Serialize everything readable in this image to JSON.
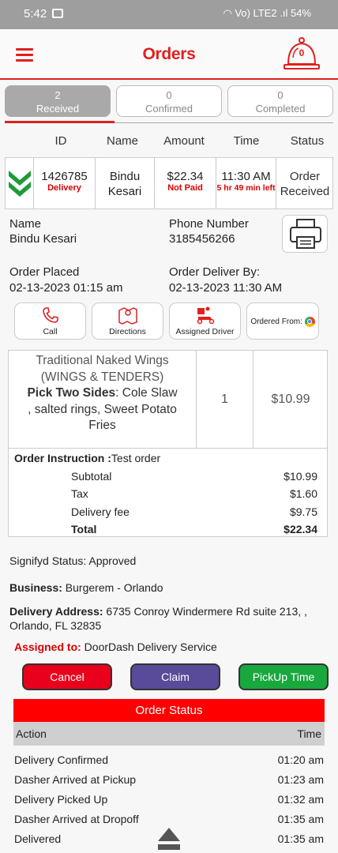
{
  "status_bar": {
    "time": "5:42",
    "right": "Vo) LTE2 .ıl 54%"
  },
  "header": {
    "title": "Orders",
    "bell_count": "0"
  },
  "tabs": [
    {
      "count": "2",
      "label": "Received"
    },
    {
      "count": "0",
      "label": "Confirmed"
    },
    {
      "count": "0",
      "label": "Completed"
    }
  ],
  "columns": [
    "ID",
    "Name",
    "Amount",
    "Time",
    "Status"
  ],
  "order": {
    "id": "1426785",
    "type": "Delivery",
    "name_first": "Bindu",
    "name_last": "Kesari",
    "amount": "$22.34",
    "payment": "Not Paid",
    "time": "11:30 AM",
    "time_left": "5 hr 49 min left",
    "status_line1": "Order",
    "status_line2": "Received"
  },
  "details": {
    "name_label": "Name",
    "name": "Bindu Kesari",
    "phone_label": "Phone Number",
    "phone": "3185456266",
    "placed_label": "Order Placed",
    "placed": "02-13-2023 01:15 am",
    "deliver_label": "Order Deliver By:",
    "deliver": "02-13-2023 11:30 AM"
  },
  "actions": {
    "call": "Call",
    "directions": "Directions",
    "driver": "Assigned Driver",
    "ordered_from": "Ordered From:"
  },
  "item": {
    "name1": "Traditional Naked Wings",
    "name2": "(WINGS & TENDERS)",
    "sides_label": "Pick Two Sides",
    "sides1": ": Cole Slaw",
    "sides2": ", salted rings, Sweet Potato",
    "sides3": "Fries",
    "qty": "1",
    "price": "$10.99"
  },
  "totals": {
    "instruction_label": "Order Instruction :",
    "instruction": "Test order",
    "subtotal_label": "Subtotal",
    "subtotal": "$10.99",
    "tax_label": "Tax",
    "tax": "$1.60",
    "fee_label": "Delivery fee",
    "fee": "$9.75",
    "total_label": "Total",
    "total": "$22.34"
  },
  "info": {
    "signifyd": "Signifyd Status: Approved",
    "business_label": "Business:",
    "business": " Burgerem - Orlando",
    "address_label": "Delivery Address:",
    "address1": " 6735 Conroy Windermere Rd suite 213, ,",
    "address2": "Orlando, FL 32835",
    "assigned_label": "Assigned to:",
    "assigned": " DoorDash Delivery Service"
  },
  "buttons": {
    "cancel": "Cancel",
    "claim": "Claim",
    "pickup": "PickUp Time"
  },
  "order_status": {
    "title": "Order Status",
    "action_header": "Action",
    "time_header": "Time",
    "rows": [
      {
        "action": "Delivery Confirmed",
        "time": "01:20 am"
      },
      {
        "action": "Dasher Arrived at Pickup",
        "time": "01:23 am"
      },
      {
        "action": "Delivery Picked Up",
        "time": "01:32 am"
      },
      {
        "action": "Dasher Arrived at Dropoff",
        "time": "01:35 am"
      },
      {
        "action": "Delivered",
        "time": "01:35 am"
      }
    ]
  },
  "colors": {
    "accent": "#e02020",
    "claim": "#5a4a9a",
    "pickup": "#19a83e",
    "cancel": "#e8001c"
  }
}
